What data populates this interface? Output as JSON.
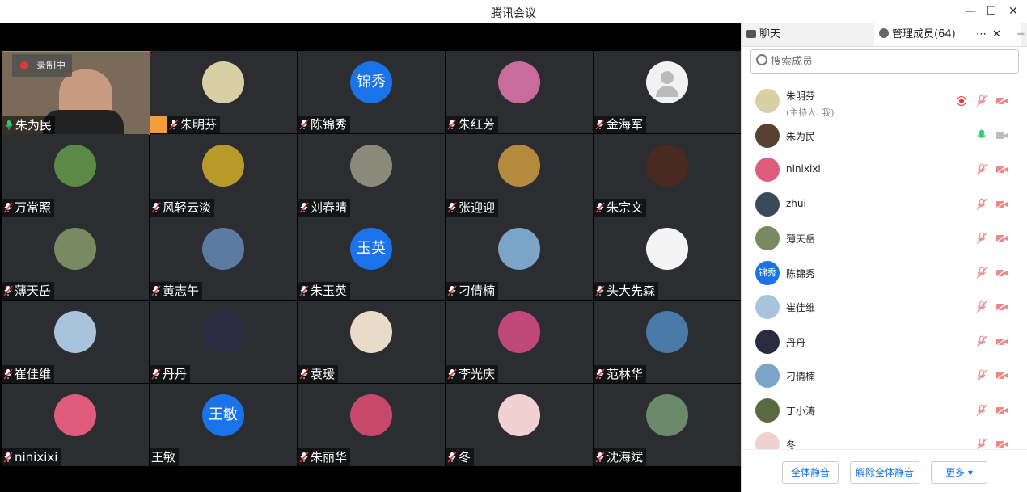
{
  "window": {
    "title": "腾讯会议"
  },
  "recording_label": "录制中",
  "tiles": [
    {
      "name": "朱为民",
      "mic": "on",
      "avatar": "video"
    },
    {
      "name": "朱明芬",
      "mic": "off",
      "avatar": "img",
      "color": "#d9cfa5",
      "host": true
    },
    {
      "name": "陈锦秀",
      "mic": "off",
      "avatar": "text",
      "text": "锦秀"
    },
    {
      "name": "朱红芳",
      "mic": "off",
      "avatar": "img",
      "color": "#c86c9c"
    },
    {
      "name": "金海军",
      "mic": "off",
      "avatar": "default"
    },
    {
      "name": "万常照",
      "mic": "off",
      "avatar": "img",
      "color": "#5a8a45"
    },
    {
      "name": "风轻云淡",
      "mic": "off",
      "avatar": "img",
      "color": "#b89a2b"
    },
    {
      "name": "刘春晴",
      "mic": "off",
      "avatar": "img",
      "color": "#8a8a7a"
    },
    {
      "name": "张迎迎",
      "mic": "off",
      "avatar": "img",
      "color": "#b48a3c"
    },
    {
      "name": "朱宗文",
      "mic": "off",
      "avatar": "img",
      "color": "#4a2a20"
    },
    {
      "name": "薄天岳",
      "mic": "off",
      "avatar": "img",
      "color": "#7a8a60"
    },
    {
      "name": "黄志午",
      "mic": "off",
      "avatar": "img",
      "color": "#5a7aa0"
    },
    {
      "name": "朱玉英",
      "mic": "off",
      "avatar": "text",
      "text": "玉英"
    },
    {
      "name": "刁倩楠",
      "mic": "off",
      "avatar": "img",
      "color": "#7aa4c8"
    },
    {
      "name": "头大先森",
      "mic": "off",
      "avatar": "img",
      "color": "#f4f4f4"
    },
    {
      "name": "崔佳维",
      "mic": "off",
      "avatar": "img",
      "color": "#a8c4dc"
    },
    {
      "name": "丹丹",
      "mic": "off",
      "avatar": "img",
      "color": "#2a2a40"
    },
    {
      "name": "袁瑗",
      "mic": "off",
      "avatar": "img",
      "color": "#e8dcc8"
    },
    {
      "name": "李光庆",
      "mic": "off",
      "avatar": "img",
      "color": "#c04878"
    },
    {
      "name": "范林华",
      "mic": "off",
      "avatar": "img",
      "color": "#4a7aa8"
    },
    {
      "name": "ninixixi",
      "mic": "off",
      "avatar": "img",
      "color": "#e05a7a"
    },
    {
      "name": "王敏",
      "mic": "none",
      "avatar": "text",
      "text": "王敏"
    },
    {
      "name": "朱丽华",
      "mic": "off",
      "avatar": "img",
      "color": "#c8486a"
    },
    {
      "name": "冬",
      "mic": "off",
      "avatar": "img",
      "color": "#f0d0d0"
    },
    {
      "name": "沈海斌",
      "mic": "off",
      "avatar": "img",
      "color": "#6a8a6a"
    }
  ],
  "panel": {
    "tab_chat": "聊天",
    "tab_members": "管理成员(64)",
    "search_placeholder": "搜索成员",
    "members": [
      {
        "name": "朱明芬",
        "sub": "(主持人, 我)",
        "avatar": "img",
        "color": "#d9cfa5",
        "state": "recording"
      },
      {
        "name": "朱为民",
        "avatar": "img",
        "color": "#5a4030",
        "state": "mic-on"
      },
      {
        "name": "ninixixi",
        "avatar": "img",
        "color": "#e05a7a",
        "state": "muted"
      },
      {
        "name": "zhui",
        "avatar": "img",
        "color": "#3a4a5a",
        "state": "muted"
      },
      {
        "name": "薄天岳",
        "avatar": "img",
        "color": "#7a8a60",
        "state": "muted"
      },
      {
        "name": "陈锦秀",
        "avatar": "text",
        "text": "锦秀",
        "state": "muted"
      },
      {
        "name": "崔佳维",
        "avatar": "img",
        "color": "#a8c4dc",
        "state": "muted"
      },
      {
        "name": "丹丹",
        "avatar": "img",
        "color": "#2a2a40",
        "state": "muted"
      },
      {
        "name": "刁倩楠",
        "avatar": "img",
        "color": "#7aa4c8",
        "state": "muted"
      },
      {
        "name": "丁小涛",
        "avatar": "img",
        "color": "#5a6a40",
        "state": "muted"
      },
      {
        "name": "冬",
        "avatar": "img",
        "color": "#f0d0d0",
        "state": "muted"
      }
    ],
    "btn_mute_all": "全体静音",
    "btn_unmute_all": "解除全体静音",
    "btn_more": "更多"
  }
}
